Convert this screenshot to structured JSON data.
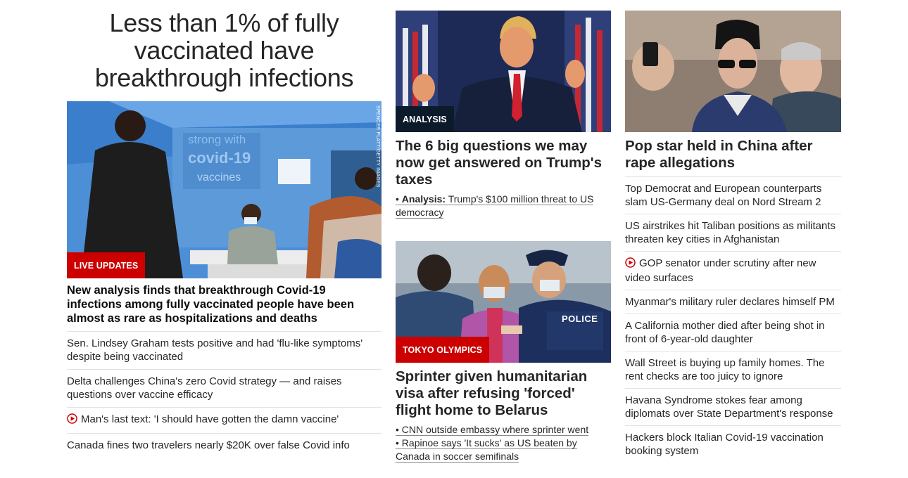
{
  "left": {
    "headline": "Less than 1% of fully vaccinated have breakthrough infections",
    "image_credit": "SPENCER PLATT/GETTY IMAGES",
    "tag": "LIVE UPDATES",
    "lead": "New analysis finds that breakthrough Covid-19 infections among fully vaccinated people have been almost as rare as hospitalizations and deaths",
    "items": [
      {
        "text": "Sen. Lindsey Graham tests positive and had 'flu-like symptoms' despite being vaccinated",
        "video": false
      },
      {
        "text": "Delta challenges China's zero Covid strategy — and raises questions over vaccine efficacy",
        "video": false
      },
      {
        "text": "Man's last text: 'I should have gotten the damn vaccine'",
        "video": true
      },
      {
        "text": "Canada fines two travelers nearly $20K over false Covid info",
        "video": false
      }
    ]
  },
  "middle": {
    "card1": {
      "tag": "ANALYSIS",
      "title": "The 6 big questions we may now get answered on Trump's taxes",
      "sub_bullet": "•",
      "sub_prefix": "Analysis:",
      "sub_text": "Trump's $100 million threat to US democracy"
    },
    "card2": {
      "tag": "TOKYO OLYMPICS",
      "police_text": "POLICE",
      "title": "Sprinter given humanitarian visa after refusing 'forced' flight home to Belarus",
      "subs": [
        "• CNN outside embassy where sprinter went",
        "• Rapinoe says 'It sucks' as US beaten by Canada in soccer semifinals"
      ]
    }
  },
  "right": {
    "title": "Pop star held in China after rape allegations",
    "items": [
      {
        "text": "Top Democrat and European counterparts slam US-Germany deal on Nord Stream 2",
        "video": false
      },
      {
        "text": "US airstrikes hit Taliban positions as militants threaten key cities in Afghanistan",
        "video": false
      },
      {
        "text": "GOP senator under scrutiny after new video surfaces",
        "video": true
      },
      {
        "text": "Myanmar's military ruler declares himself PM",
        "video": false
      },
      {
        "text": "A California mother died after being shot in front of 6-year-old daughter",
        "video": false
      },
      {
        "text": "Wall Street is buying up family homes. The rent checks are too juicy to ignore",
        "video": false
      },
      {
        "text": "Havana Syndrome stokes fear among diplomats over State Department's response",
        "video": false
      },
      {
        "text": "Hackers block Italian Covid-19 vaccination booking system",
        "video": false
      }
    ]
  },
  "colors": {
    "tag_red": "#cc0000",
    "tag_navy": "#0c1b2b",
    "divider": "#e2e2e2"
  },
  "icons": {
    "video": "play-circle-icon"
  }
}
